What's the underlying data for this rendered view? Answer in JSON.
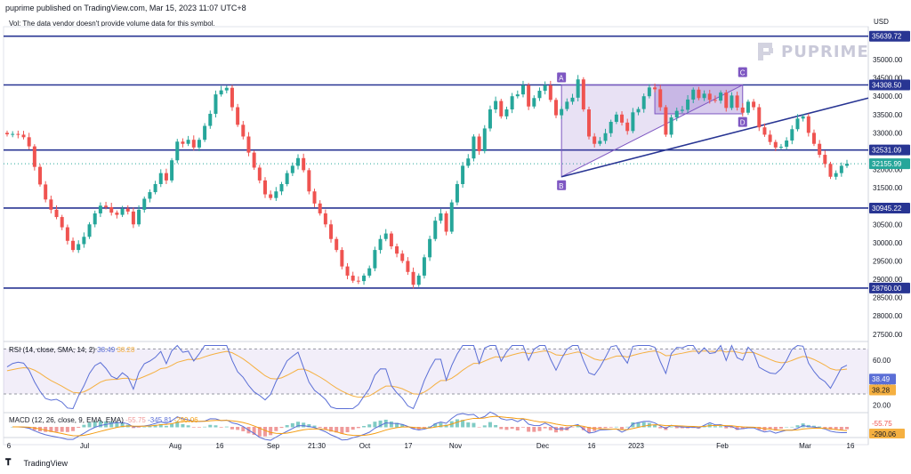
{
  "header": {
    "published": "puprime published on TradingView.com, Mar 15, 2023 11:07 UTC+8",
    "vol_note": "Vol: The data vendor doesn't provide volume data for this symbol.",
    "currency": "USD"
  },
  "watermark": {
    "brand": "PUPRIME"
  },
  "footer": {
    "brand": "TradingView"
  },
  "colors": {
    "up": "#26a69a",
    "down": "#ef5350",
    "hline": "#283593",
    "pattern": "#7e57c2",
    "rsi": "#5b6fd6",
    "rsi_ma": "#f5b041",
    "macd": "#5b6fd6",
    "signal": "#f39c12"
  },
  "chart_data": {
    "type": "candlestick",
    "symbol_currency": "USD",
    "y_axis": {
      "ticks": [
        "35000.00",
        "34500.00",
        "34000.00",
        "33500.00",
        "33000.00",
        "32500.00",
        "32000.00",
        "31500.00",
        "31000.00",
        "30500.00",
        "30000.00",
        "29500.00",
        "29000.00",
        "28500.00",
        "28000.00",
        "27500.00"
      ],
      "range": [
        27300,
        35900
      ]
    },
    "x_axis": {
      "labels": [
        "6",
        "Jul",
        "Aug",
        "16",
        "Sep",
        "21:30",
        "Oct",
        "17",
        "Nov",
        "Dec",
        "16",
        "2023",
        "Feb",
        "Mar",
        "16"
      ]
    },
    "horizontal_levels": [
      {
        "label": "35639.72",
        "value": 35639.72
      },
      {
        "label": "34308.50",
        "value": 34308.5
      },
      {
        "label": "32531.09",
        "value": 32531.09
      },
      {
        "label": "30945.22",
        "value": 30945.22
      },
      {
        "label": "28760.00",
        "value": 28760.0
      }
    ],
    "last_price": {
      "label": "32155.99",
      "value": 32155.99
    },
    "pattern_points": [
      {
        "label": "A",
        "value": 34308.5
      },
      {
        "label": "B",
        "value": 31800
      },
      {
        "label": "C",
        "value": 34450
      },
      {
        "label": "D",
        "value": 33480
      }
    ],
    "closes": [
      32960,
      32970,
      32950,
      32880,
      32630,
      32070,
      31590,
      31180,
      30900,
      30700,
      30420,
      30050,
      29800,
      29960,
      30160,
      30500,
      30800,
      31010,
      30970,
      30820,
      30760,
      30930,
      30850,
      30500,
      30900,
      31200,
      31380,
      31600,
      31900,
      31700,
      32250,
      32760,
      32700,
      32810,
      32600,
      32810,
      33190,
      33520,
      34050,
      34160,
      34230,
      33700,
      33220,
      32900,
      32460,
      32050,
      31700,
      31320,
      31220,
      31400,
      31600,
      31900,
      32100,
      32310,
      31980,
      31400,
      31070,
      30800,
      30500,
      30100,
      29800,
      29350,
      29100,
      28960,
      28950,
      29100,
      29300,
      29800,
      30100,
      30250,
      29900,
      29700,
      29500,
      29200,
      28850,
      29100,
      29600,
      30100,
      30600,
      30800,
      30300,
      31100,
      31600,
      32100,
      32300,
      32900,
      32500,
      33120,
      33640,
      33870,
      33450,
      33640,
      34000,
      34050,
      34300,
      33720,
      33950,
      34150,
      34300,
      33900,
      33480,
      33650,
      33850,
      33960,
      34460,
      33640,
      32900,
      32700,
      32780,
      32990,
      33300,
      33500,
      33280,
      33050,
      33560,
      33650,
      34000,
      34240,
      34190,
      33700,
      32950,
      33420,
      33600,
      33630,
      33910,
      34180,
      33950,
      34070,
      33900,
      33880,
      34100,
      33680,
      34020,
      33690,
      33550,
      33850,
      33700,
      33150,
      32950,
      32750,
      32600,
      32620,
      32790,
      33100,
      33390,
      33450,
      33000,
      32700,
      32400,
      32150,
      31800,
      31900,
      32100,
      32155.99
    ],
    "rsi": {
      "label": "RSI (14, close, SMA, 14, 2)",
      "value_label": "38.49",
      "ma_label": "38.28",
      "values": [
        38.49,
        38.28
      ],
      "ticks": [
        "60.00",
        "40.00",
        "20.00"
      ],
      "range": [
        15,
        75
      ],
      "bands": [
        70,
        30
      ]
    },
    "macd": {
      "label": "MACD (12, 26, close, 9, EMA, EMA)",
      "series_labels": [
        "-55.75",
        "-345.81",
        "-290.06"
      ],
      "value_label": "-55.75",
      "signal_label": "-290.06",
      "values": [
        -55.75,
        -345.81,
        -290.06
      ]
    }
  }
}
